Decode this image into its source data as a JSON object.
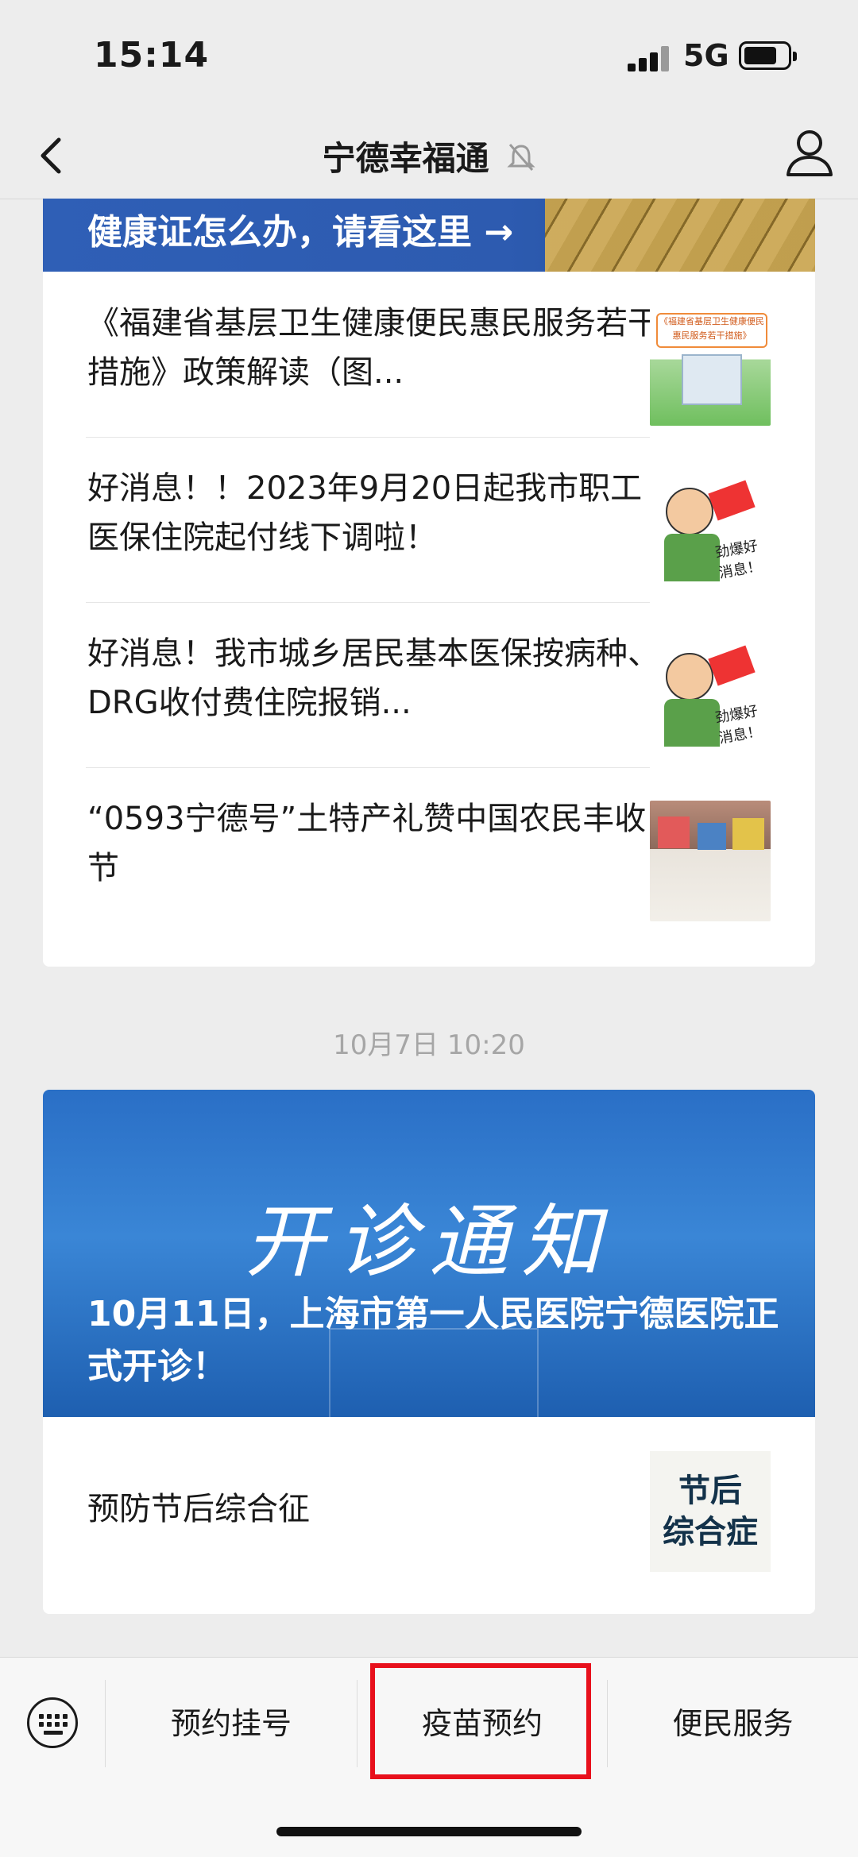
{
  "status_bar": {
    "time": "15:14",
    "network": "5G"
  },
  "nav": {
    "title": "宁德幸福通"
  },
  "banner_top": {
    "text": "健康证怎么办，请看这里"
  },
  "articles": [
    {
      "title": "《福建省基层卫生健康便民惠民服务若干措施》政策解读（图...",
      "thumb_text": "《福建省基层卫生健康便民惠民服务若干措施》"
    },
    {
      "title": "好消息！！2023年9月20日起我市职工医保住院起付线下调啦！",
      "thumb_text": "劲爆好消息！"
    },
    {
      "title": "好消息！我市城乡居民基本医保按病种、DRG收付费住院报销...",
      "thumb_text": "劲爆好消息！"
    },
    {
      "title": "“0593宁德号”土特产礼赞中国农民丰收节",
      "thumb_text": ""
    }
  ],
  "timestamp": "10月7日 10:20",
  "hero": {
    "big_text": "开诊通知",
    "sub_text": "10月11日，上海市第一人民医院宁德医院正式开诊！"
  },
  "card2_article": {
    "title": "预防节后综合征",
    "thumb_line1": "节后",
    "thumb_line2": "综合症"
  },
  "menu": {
    "items": [
      "预约挂号",
      "疫苗预约",
      "便民服务"
    ]
  },
  "colors": {
    "highlight": "#e8101c",
    "hero_blue": "#2a6fc6"
  }
}
